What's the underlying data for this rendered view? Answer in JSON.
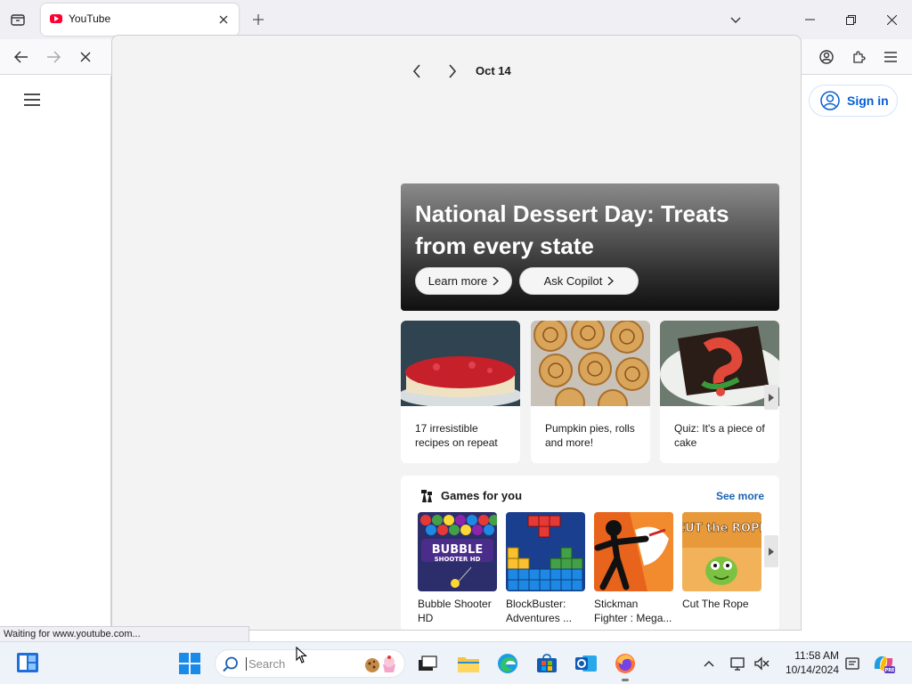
{
  "browser": {
    "tab_title": "YouTube",
    "status_text": "Waiting for www.youtube.com..."
  },
  "youtube": {
    "signin_label": "Sign in"
  },
  "widgets": {
    "date": "Oct 14",
    "hero": {
      "title": "National Dessert Day: Treats from every state",
      "learn_more": "Learn more",
      "ask_copilot": "Ask Copilot"
    },
    "cards": [
      {
        "text": "17 irresistible recipes on repeat"
      },
      {
        "text": "Pumpkin pies, rolls and more!"
      },
      {
        "text": "Quiz: It's a piece of cake"
      }
    ],
    "games": {
      "title": "Games for you",
      "see_more": "See more",
      "items": [
        {
          "name": "Bubble Shooter HD",
          "thumb_text": "BUBBLE",
          "thumb_sub": "SHOOTER HD"
        },
        {
          "name": "BlockBuster: Adventures ..."
        },
        {
          "name": "Stickman Fighter : Mega..."
        },
        {
          "name": "Cut The Rope",
          "thumb_text": "CUT the ROPE"
        }
      ]
    }
  },
  "taskbar": {
    "search_placeholder": "Search",
    "time": "11:58 AM",
    "date": "10/14/2024"
  },
  "colors": {
    "accent": "#065fd4",
    "see_more": "#1964b4",
    "youtube_red": "#ff0033"
  },
  "icons": [
    "tab-list-icon",
    "close-icon",
    "plus-icon",
    "chevron-down-icon",
    "minimize-icon",
    "restore-icon",
    "back-icon",
    "forward-icon",
    "stop-icon",
    "account-icon",
    "extensions-icon",
    "menu-icon",
    "hamburger-icon",
    "user-icon",
    "chevron-left-icon",
    "chevron-right-icon",
    "games-icon",
    "search-icon",
    "windows-start-icon",
    "widgets-icon",
    "file-explorer-icon",
    "edge-icon",
    "store-icon",
    "outlook-icon",
    "firefox-icon",
    "task-view-icon"
  ]
}
